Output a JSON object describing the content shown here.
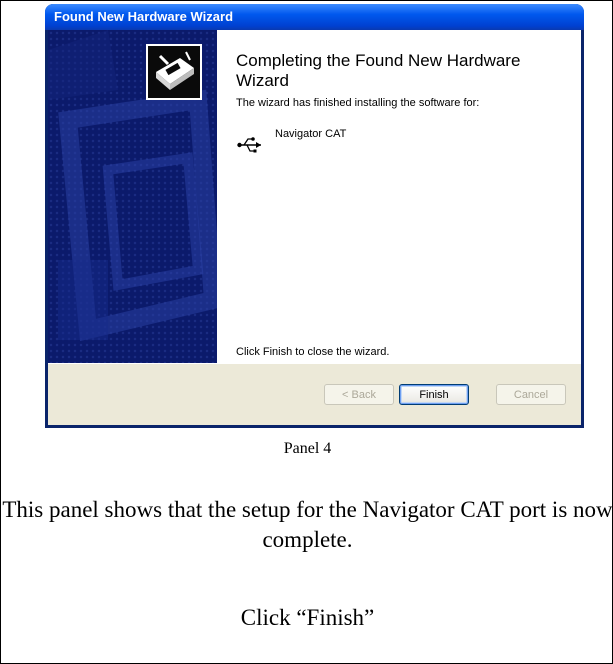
{
  "wizard": {
    "title": "Found New Hardware Wizard",
    "heading": "Completing the Found New Hardware Wizard",
    "subtext": "The wizard has finished installing the software for:",
    "device_icon": "usb-icon",
    "device_name": "Navigator CAT",
    "footer_text": "Click Finish to close the wizard.",
    "buttons": {
      "back": "< Back",
      "finish": "Finish",
      "cancel": "Cancel"
    }
  },
  "caption": {
    "panel_label": "Panel 4",
    "description": "This panel shows that the setup for the Navigator CAT port is now complete.",
    "instruction": "Click “Finish”"
  }
}
